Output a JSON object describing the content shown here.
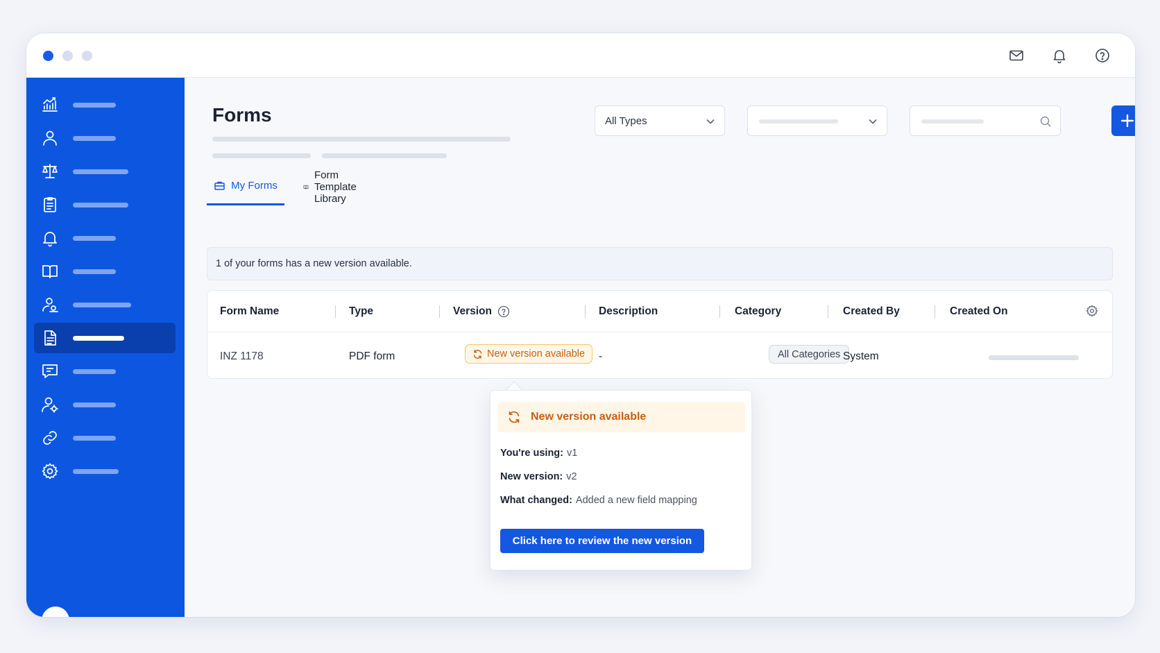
{
  "page": {
    "title": "Forms"
  },
  "filters": {
    "type_select": "All Types"
  },
  "tabs": [
    {
      "label": "My Forms",
      "active": true,
      "icon": "briefcase-icon"
    },
    {
      "label": "Form Template Library",
      "active": false,
      "icon": "book-open-icon"
    }
  ],
  "notice": {
    "text": "1 of your forms has a new version available."
  },
  "table": {
    "columns": [
      "Form Name",
      "Type",
      "Version",
      "Description",
      "Category",
      "Created By",
      "Created On"
    ],
    "rows": [
      {
        "form_name": "INZ 1178",
        "type": "PDF form",
        "version_badge": "New version available",
        "description": "-",
        "category": "All Categories",
        "created_by": "System"
      }
    ]
  },
  "popover": {
    "title": "New version available",
    "using_label": "You're using:",
    "using_value": "v1",
    "new_label": "New version:",
    "new_value": "v2",
    "changed_label": "What changed:",
    "changed_value": "Added a new field mapping",
    "button_label": "Click here to review the new version"
  },
  "colors": {
    "primary": "#1457e1",
    "sidebar": "#0d57e0",
    "sidebar_active": "#0a3fae",
    "warning_text": "#c85f10",
    "warning_bg": "#fff7e6"
  },
  "sidebar_icons": [
    "chart-icon",
    "user-icon",
    "scale-icon",
    "clipboard-icon",
    "bell-icon",
    "book-icon",
    "user-group-icon",
    "document-icon",
    "chat-icon",
    "user-settings-icon",
    "link-icon",
    "gear-icon"
  ]
}
